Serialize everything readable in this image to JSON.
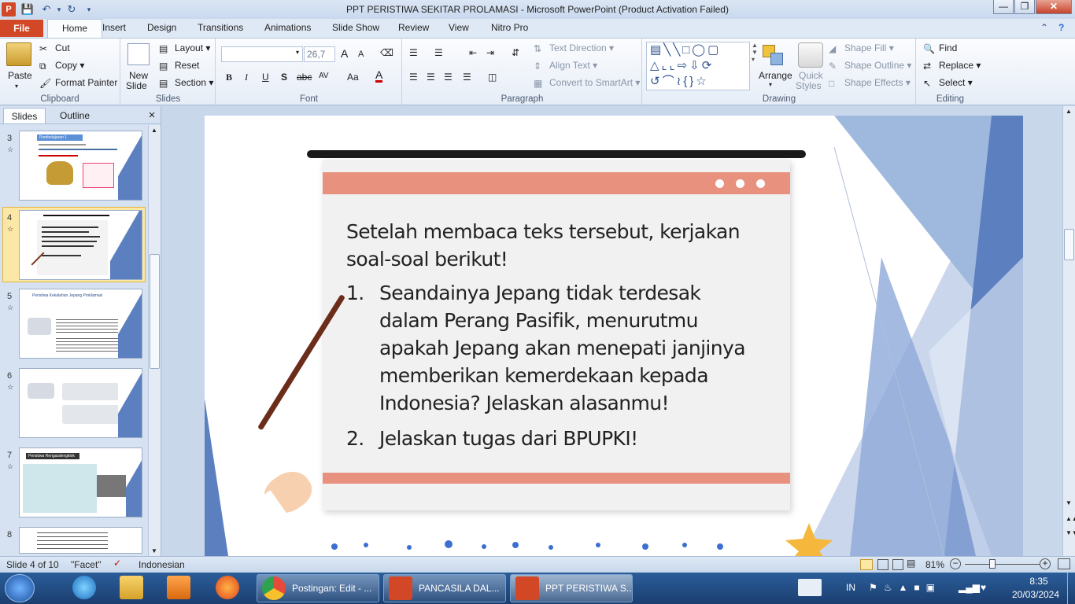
{
  "window": {
    "title": "PPT PERISTIWA SEKITAR PROLAMASI  -  Microsoft PowerPoint (Product Activation Failed)"
  },
  "ribbon_tabs": [
    "File",
    "Home",
    "Insert",
    "Design",
    "Transitions",
    "Animations",
    "Slide Show",
    "Review",
    "View",
    "Nitro Pro"
  ],
  "clipboard": {
    "paste": "Paste",
    "cut": "Cut",
    "copy": "Copy",
    "format_painter": "Format Painter",
    "label": "Clipboard"
  },
  "slides_group": {
    "new_slide_1": "New",
    "new_slide_2": "Slide",
    "layout": "Layout",
    "reset": "Reset",
    "section": "Section",
    "label": "Slides"
  },
  "font_group": {
    "font_name": "",
    "font_size": "26,7",
    "bold": "B",
    "italic": "I",
    "underline": "U",
    "shadow": "S",
    "strike": "abc",
    "spacing": "AV",
    "case": "Aa",
    "color": "A",
    "grow": "A",
    "shrink": "A",
    "label": "Font"
  },
  "paragraph_group": {
    "text_direction": "Text Direction",
    "align_text": "Align Text",
    "smartart": "Convert to SmartArt",
    "label": "Paragraph"
  },
  "drawing_group": {
    "arrange": "Arrange",
    "quick_styles_1": "Quick",
    "quick_styles_2": "Styles",
    "shape_fill": "Shape Fill",
    "shape_outline": "Shape Outline",
    "shape_effects": "Shape Effects",
    "label": "Drawing"
  },
  "editing_group": {
    "find": "Find",
    "replace": "Replace",
    "select": "Select",
    "label": "Editing"
  },
  "left_pane": {
    "tabs": [
      "Slides",
      "Outline"
    ],
    "close": "×",
    "thumbs": [
      {
        "num": "3",
        "title": "Pembelajaran 1"
      },
      {
        "num": "4",
        "title": ""
      },
      {
        "num": "5",
        "title": "Peristiwa Kekalahan Jepang Proklamasi"
      },
      {
        "num": "6",
        "title": ""
      },
      {
        "num": "7",
        "title": "Peristiwa Rengasdengklok"
      },
      {
        "num": "8",
        "title": ""
      }
    ]
  },
  "slide": {
    "intro": "Setelah membaca teks tersebut, kerjakan soal-soal berikut!",
    "q1_num": "1.",
    "q1": "Seandainya Jepang tidak terdesak dalam Perang Pasifik, menurutmu apakah Jepang akan menepati janjinya memberikan kemerdekaan kepada Indonesia? Jelaskan alasanmu!",
    "q2_num": "2.",
    "q2": "Jelaskan tugas dari BPUPKI!",
    "colors": {
      "accent": "#e8917e",
      "board": "#f1f1f1",
      "blue_light": "#b9cbe8",
      "blue_dark": "#5b7fbf"
    }
  },
  "status": {
    "slide_of": "Slide 4 of 10",
    "theme": "\"Facet\"",
    "language": "Indonesian",
    "zoom": "81%"
  },
  "taskbar": {
    "items": [
      "Postingan: Edit - ...",
      "PANCASILA DAL...",
      "PPT PERISTIWA S..."
    ],
    "lang": "IN",
    "time": "8:35",
    "date": "20/03/2024"
  }
}
